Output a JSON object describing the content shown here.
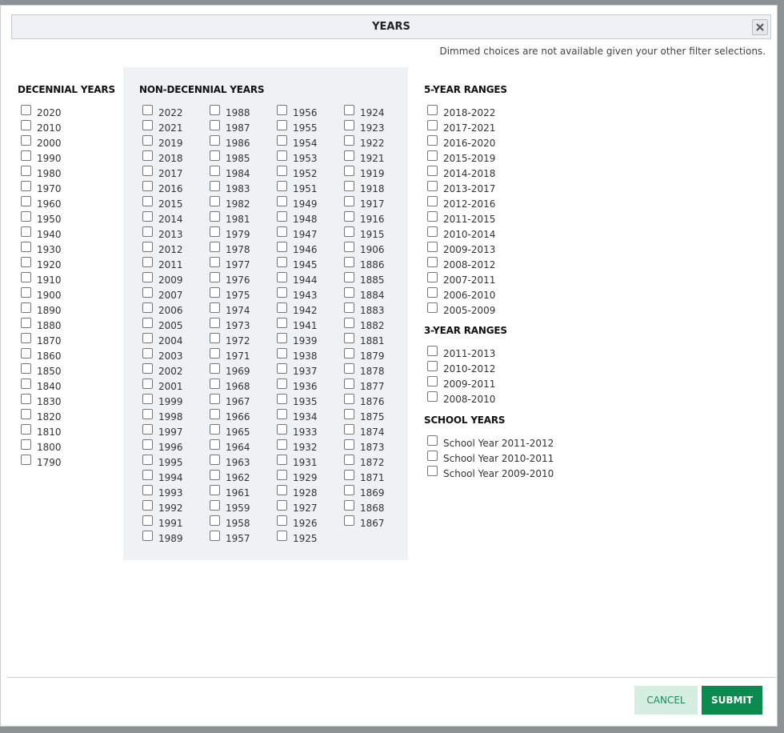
{
  "dialog": {
    "title": "YEARS",
    "hint": "Dimmed choices are not available given your other filter selections."
  },
  "decennial": {
    "title": "DECENNIAL YEARS",
    "items": [
      "2020",
      "2010",
      "2000",
      "1990",
      "1980",
      "1970",
      "1960",
      "1950",
      "1940",
      "1930",
      "1920",
      "1910",
      "1900",
      "1890",
      "1880",
      "1870",
      "1860",
      "1850",
      "1840",
      "1830",
      "1820",
      "1810",
      "1800",
      "1790"
    ]
  },
  "non_decennial": {
    "title": "NON-DECENNIAL YEARS",
    "columns": [
      [
        "2022",
        "2021",
        "2019",
        "2018",
        "2017",
        "2016",
        "2015",
        "2014",
        "2013",
        "2012",
        "2011",
        "2009",
        "2007",
        "2006",
        "2005",
        "2004",
        "2003",
        "2002",
        "2001",
        "1999",
        "1998",
        "1997",
        "1996",
        "1995",
        "1994",
        "1993",
        "1992",
        "1991",
        "1989"
      ],
      [
        "1988",
        "1987",
        "1986",
        "1985",
        "1984",
        "1983",
        "1982",
        "1981",
        "1979",
        "1978",
        "1977",
        "1976",
        "1975",
        "1974",
        "1973",
        "1972",
        "1971",
        "1969",
        "1968",
        "1967",
        "1966",
        "1965",
        "1964",
        "1963",
        "1962",
        "1961",
        "1959",
        "1958",
        "1957"
      ],
      [
        "1956",
        "1955",
        "1954",
        "1953",
        "1952",
        "1951",
        "1949",
        "1948",
        "1947",
        "1946",
        "1945",
        "1944",
        "1943",
        "1942",
        "1941",
        "1939",
        "1938",
        "1937",
        "1936",
        "1935",
        "1934",
        "1933",
        "1932",
        "1931",
        "1929",
        "1928",
        "1927",
        "1926",
        "1925"
      ],
      [
        "1924",
        "1923",
        "1922",
        "1921",
        "1919",
        "1918",
        "1917",
        "1916",
        "1915",
        "1906",
        "1886",
        "1885",
        "1884",
        "1883",
        "1882",
        "1881",
        "1879",
        "1878",
        "1877",
        "1876",
        "1875",
        "1874",
        "1873",
        "1872",
        "1871",
        "1869",
        "1868",
        "1867"
      ]
    ]
  },
  "five_year": {
    "title": "5-YEAR RANGES",
    "items": [
      "2018-2022",
      "2017-2021",
      "2016-2020",
      "2015-2019",
      "2014-2018",
      "2013-2017",
      "2012-2016",
      "2011-2015",
      "2010-2014",
      "2009-2013",
      "2008-2012",
      "2007-2011",
      "2006-2010",
      "2005-2009"
    ]
  },
  "three_year": {
    "title": "3-YEAR RANGES",
    "items": [
      "2011-2013",
      "2010-2012",
      "2009-2011",
      "2008-2010"
    ]
  },
  "school_years": {
    "title": "SCHOOL YEARS",
    "items": [
      "School Year 2011-2012",
      "School Year 2010-2011",
      "School Year 2009-2010"
    ]
  },
  "footer": {
    "cancel_label": "CANCEL",
    "submit_label": "SUBMIT"
  }
}
